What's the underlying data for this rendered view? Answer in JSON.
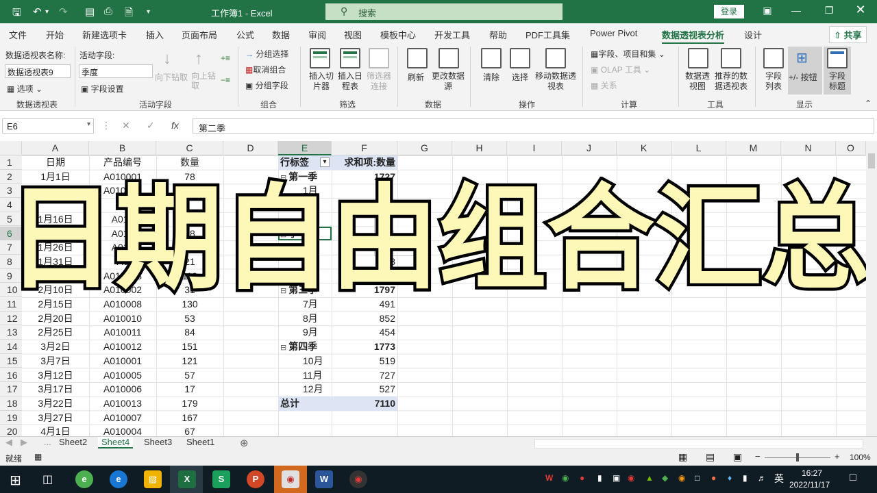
{
  "titlebar": {
    "title": "工作簿1 - Excel",
    "search": "搜索",
    "login": "登录"
  },
  "menu": {
    "tabs": [
      "文件",
      "开始",
      "新建选项卡",
      "插入",
      "页面布局",
      "公式",
      "数据",
      "审阅",
      "视图",
      "模板中心",
      "开发工具",
      "帮助",
      "PDF工具集",
      "Power Pivot",
      "数据透视表分析",
      "设计"
    ],
    "active": "数据透视表分析",
    "share": "共享"
  },
  "ribbon": {
    "pivot_name_label": "数据透视表名称:",
    "pivot_name_value": "数据透视表9",
    "options_label": "选项",
    "group_pivot": "数据透视表",
    "active_field_label": "活动字段:",
    "active_field_value": "季度",
    "field_settings": "字段设置",
    "drill_down": "向下钻取",
    "drill_up": "向上钻取",
    "group_active_field": "活动字段",
    "group_selection": "分组选择",
    "ungroup": "取消组合",
    "group_field": "分组字段",
    "group_group": "组合",
    "insert_slicer": "插入切片器",
    "insert_timeline": "插入日程表",
    "filter_connections": "筛选器连接",
    "group_filter": "筛选",
    "refresh": "刷新",
    "change_source": "更改数据源",
    "group_data": "数据",
    "clear": "清除",
    "select": "选择",
    "move_pivot": "移动数据透视表",
    "group_actions": "操作",
    "fields_items_sets": "字段、项目和集",
    "olap_tools": "OLAP 工具",
    "relationships": "关系",
    "group_calc": "计算",
    "pivot_chart": "数据透视图",
    "recommended": "推荐的数据透视表",
    "group_tools": "工具",
    "field_list": "字段列表",
    "plus_minus": "+/- 按钮",
    "field_headers": "字段标题",
    "group_show": "显示"
  },
  "formula_bar": {
    "name_box": "E6",
    "formula": "第二季",
    "fx": "fx"
  },
  "columns": [
    "A",
    "B",
    "C",
    "D",
    "E",
    "F",
    "G",
    "H",
    "I",
    "J",
    "K",
    "L",
    "M",
    "N",
    "O"
  ],
  "rows": [
    "1",
    "2",
    "3",
    "4",
    "5",
    "6",
    "7",
    "8",
    "9",
    "10",
    "11",
    "12",
    "13",
    "14",
    "15",
    "16",
    "17",
    "18",
    "19",
    "20"
  ],
  "source_table": {
    "headers": [
      "日期",
      "产品编号",
      "数量"
    ],
    "rows": [
      [
        "1月1日",
        "A010001",
        "78"
      ],
      [
        "1月6日",
        "A010005",
        "166"
      ],
      [
        "",
        "A0",
        ""
      ],
      [
        "1月16日",
        "A010",
        ""
      ],
      [
        "",
        "A010",
        "28"
      ],
      [
        "1月26日",
        "A010",
        ""
      ],
      [
        "1月31日",
        "A0",
        "21"
      ],
      [
        "",
        "A010003",
        "119"
      ],
      [
        "2月10日",
        "A010002",
        "31"
      ],
      [
        "2月15日",
        "A010008",
        "130"
      ],
      [
        "2月20日",
        "A010010",
        "53"
      ],
      [
        "2月25日",
        "A010011",
        "84"
      ],
      [
        "3月2日",
        "A010012",
        "151"
      ],
      [
        "3月7日",
        "A010001",
        "121"
      ],
      [
        "3月12日",
        "A010005",
        "57"
      ],
      [
        "3月17日",
        "A010006",
        "17"
      ],
      [
        "3月22日",
        "A010013",
        "179"
      ],
      [
        "3月27日",
        "A010007",
        "167"
      ],
      [
        "4月1日",
        "A010004",
        "67"
      ]
    ]
  },
  "pivot": {
    "row_label_header": "行标签",
    "value_header": "求和项:数量",
    "rows": [
      {
        "label": "第一季",
        "value": "1727",
        "level": "group"
      },
      {
        "label": "1月",
        "value": "",
        "level": "item"
      },
      {
        "label": "",
        "value": "",
        "level": "item"
      },
      {
        "label": "",
        "value": "",
        "level": "item"
      },
      {
        "label": "季",
        "value": "1",
        "level": "group"
      },
      {
        "label": "",
        "value": "",
        "level": "item"
      },
      {
        "label": "",
        "value": "3",
        "level": "item"
      },
      {
        "label": "",
        "value": "",
        "level": "item"
      },
      {
        "label": "第三季",
        "value": "1797",
        "level": "group"
      },
      {
        "label": "7月",
        "value": "491",
        "level": "item"
      },
      {
        "label": "8月",
        "value": "852",
        "level": "item"
      },
      {
        "label": "9月",
        "value": "454",
        "level": "item"
      },
      {
        "label": "第四季",
        "value": "1773",
        "level": "group"
      },
      {
        "label": "10月",
        "value": "519",
        "level": "item"
      },
      {
        "label": "11月",
        "value": "727",
        "level": "item"
      },
      {
        "label": "12月",
        "value": "527",
        "level": "item"
      }
    ],
    "total_label": "总计",
    "total_value": "7110",
    "tooltip_partial": "14",
    "tooltip_partial2": "月"
  },
  "overlay_title": "日期自由组合汇总",
  "sheet_tabs": [
    "Sheet2",
    "Sheet4",
    "Sheet3",
    "Sheet1"
  ],
  "active_sheet": "Sheet4",
  "status": {
    "ready": "就绪",
    "zoom": "100%"
  },
  "taskbar": {
    "time": "16:27",
    "date": "2022/11/17",
    "ime": "英"
  },
  "colors": {
    "excel_green": "#217346",
    "pivot_header_bg": "#dde5f4",
    "overlay_fill": "#fdf8b8",
    "overlay_stroke": "#000000",
    "taskbar": "#101c24"
  }
}
